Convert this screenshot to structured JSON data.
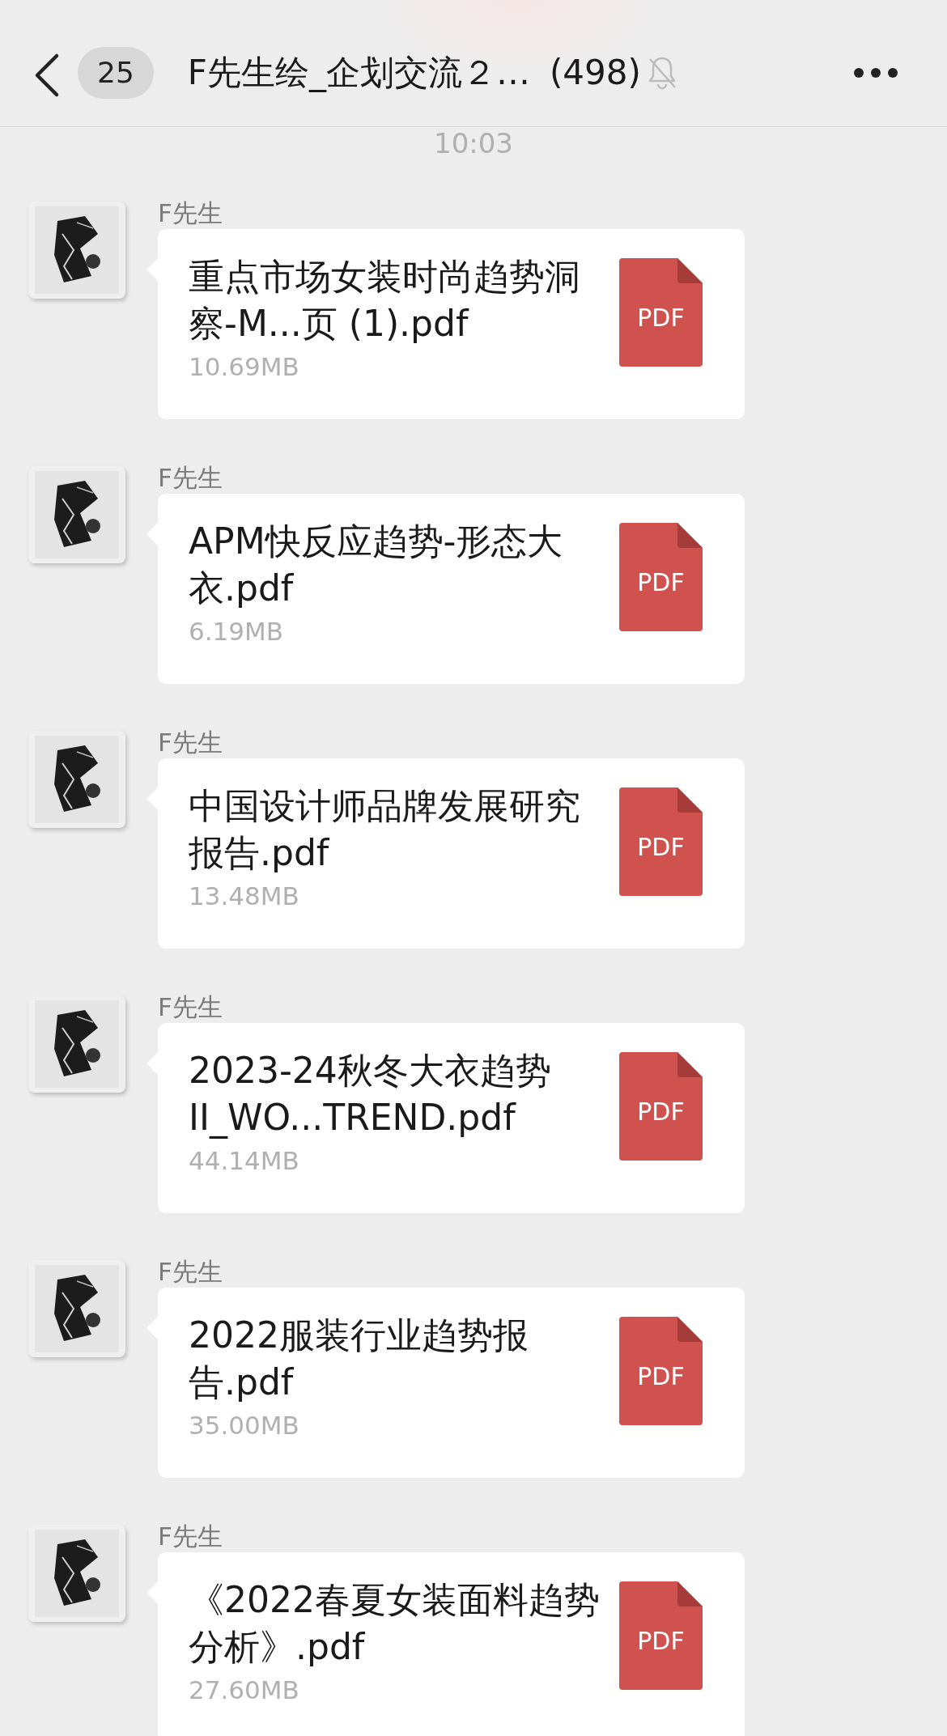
{
  "header": {
    "unread_count": "25",
    "title": "F先生绘_企划交流２…",
    "member_count": "(498)",
    "muted": true
  },
  "timestamp": "10:03",
  "messages": [
    {
      "sender": "F先生",
      "file_name": "重点市场女装时尚趋势洞察-M...页 (1).pdf",
      "file_size": "10.69MB",
      "file_type": "PDF"
    },
    {
      "sender": "F先生",
      "file_name": "APM快反应趋势-形态大衣.pdf",
      "file_size": "6.19MB",
      "file_type": "PDF"
    },
    {
      "sender": "F先生",
      "file_name": "中国设计师品牌发展研究报告.pdf",
      "file_size": "13.48MB",
      "file_type": "PDF"
    },
    {
      "sender": "F先生",
      "file_name": "2023-24秋冬大衣趋势II_WO...TREND.pdf",
      "file_size": "44.14MB",
      "file_type": "PDF"
    },
    {
      "sender": "F先生",
      "file_name": "2022服装行业趋势报告.pdf",
      "file_size": "35.00MB",
      "file_type": "PDF"
    },
    {
      "sender": "F先生",
      "file_name": "《2022春夏女装面料趋势分析》.pdf",
      "file_size": "27.60MB",
      "file_type": "PDF"
    }
  ]
}
